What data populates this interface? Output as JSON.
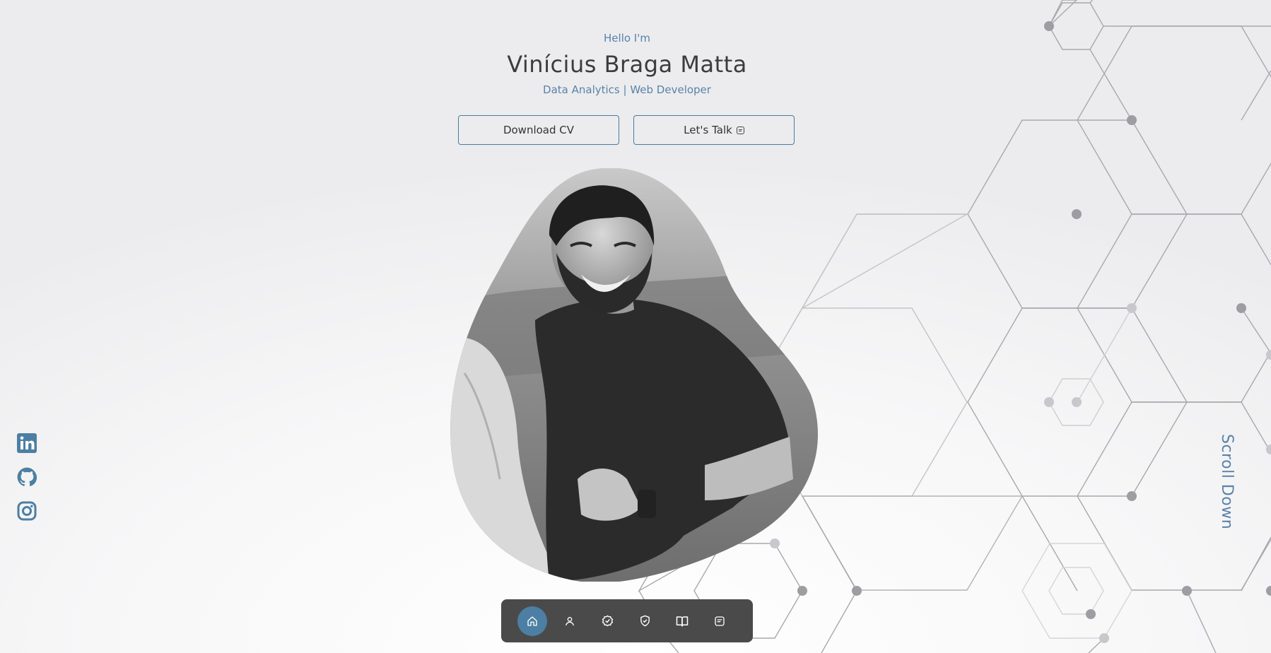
{
  "hero": {
    "greeting": "Hello I'm",
    "name": "Vinícius Braga Matta",
    "role": "Data Analytics | Web Developer",
    "download_label": "Download CV",
    "talk_label": "Let's Talk"
  },
  "portrait": {
    "alt": "Portrait of Vinícius Braga Matta"
  },
  "social": [
    {
      "icon": "linkedin-icon"
    },
    {
      "icon": "github-icon"
    },
    {
      "icon": "instagram-icon"
    }
  ],
  "scroll_label": "Scroll Down",
  "nav": [
    {
      "icon": "home-icon",
      "active": true
    },
    {
      "icon": "user-icon",
      "active": false
    },
    {
      "icon": "badge-check-icon",
      "active": false
    },
    {
      "icon": "shield-check-icon",
      "active": false
    },
    {
      "icon": "book-icon",
      "active": false
    },
    {
      "icon": "message-icon",
      "active": false
    }
  ],
  "colors": {
    "accent": "#4c7fa3",
    "text_accent": "#5a82a8",
    "navbar": "#4a4a4a",
    "hex_line": "#a9a9ad"
  }
}
